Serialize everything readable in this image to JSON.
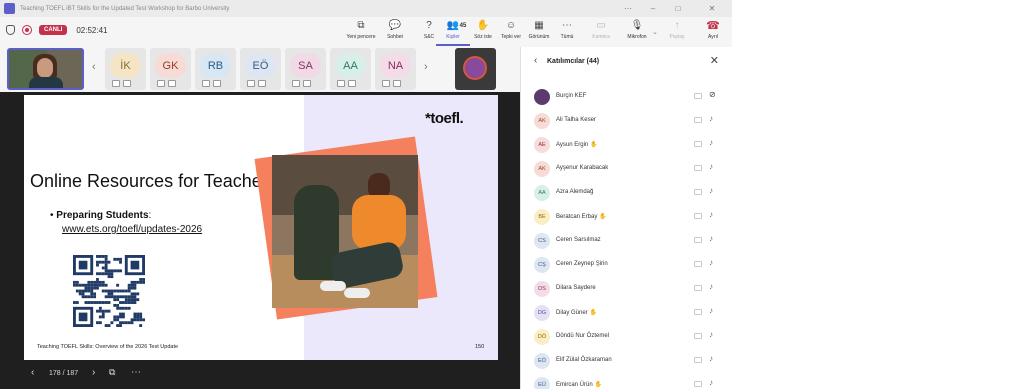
{
  "window": {
    "title": "Teaching TOEFL iBT Skills for the Updated Test Workshop for Barbo University",
    "controls": [
      "–",
      "□",
      "✕"
    ],
    "extra_controls": [
      "⋯",
      "⧉"
    ]
  },
  "meeting": {
    "live_label": "CANLI",
    "timer": "02:52:41"
  },
  "toolbar": [
    {
      "key": "new_window",
      "label": "Yeni pencere",
      "icon": "⧉",
      "state": "normal"
    },
    {
      "key": "chat",
      "label": "Sohbet",
      "icon": "💬",
      "state": "normal"
    },
    {
      "key": "qa",
      "label": "S&C",
      "icon": "?",
      "state": "normal"
    },
    {
      "key": "people",
      "label": "Kişiler",
      "icon": "👥",
      "count": "45",
      "state": "selected"
    },
    {
      "key": "raise",
      "label": "Söz iste",
      "icon": "✋",
      "state": "normal"
    },
    {
      "key": "react",
      "label": "Tepki ver",
      "icon": "☺",
      "state": "normal"
    },
    {
      "key": "view",
      "label": "Görünüm",
      "icon": "▦",
      "state": "normal"
    },
    {
      "key": "more",
      "label": "Tümü",
      "icon": "⋯",
      "state": "normal"
    },
    {
      "key": "camera",
      "label": "Kamera",
      "icon": "▭",
      "state": "disabled"
    },
    {
      "key": "mic",
      "label": "Mikrofon",
      "icon": "🎙",
      "state": "normal"
    },
    {
      "key": "share",
      "label": "Paylaş",
      "icon": "↑",
      "state": "disabled"
    },
    {
      "key": "leave",
      "label": "Ayrıl",
      "icon": "☎",
      "state": "hangup"
    }
  ],
  "gallery": {
    "nav_prev": "‹",
    "nav_next": "›",
    "tiles": [
      {
        "initials": "İK",
        "bg": "#f6e4c6",
        "fg": "#8a6a2a"
      },
      {
        "initials": "GK",
        "bg": "#f7dcd6",
        "fg": "#9a3b2a"
      },
      {
        "initials": "RB",
        "bg": "#d8e7f4",
        "fg": "#2d5a85"
      },
      {
        "initials": "EÖ",
        "bg": "#dde6f2",
        "fg": "#3b5a80"
      },
      {
        "initials": "SA",
        "bg": "#f1d9e5",
        "fg": "#8a3060"
      },
      {
        "initials": "AA",
        "bg": "#d7efe8",
        "fg": "#2c7a66"
      },
      {
        "initials": "NA",
        "bg": "#f3dce7",
        "fg": "#8a2e5c"
      }
    ]
  },
  "slide": {
    "logo": "*toefl.",
    "title": "Online Resources for Teachers",
    "bullet_label": "Preparing Students",
    "bullet_colon": ":",
    "link": "www.ets.org/toefl/updates-2026",
    "footer": "Teaching TOEFL Skills: Overview of the 2026 Test Update",
    "page": "150"
  },
  "nav": {
    "prev": "‹",
    "page_indicator": "178 / 187",
    "next": "›",
    "more": "⋯"
  },
  "panel": {
    "back": "‹",
    "title": "Katılımcılar (44)",
    "close": "✕",
    "participants": [
      {
        "initials": "",
        "name": "Burçin KEF",
        "photo": true,
        "mic": "off",
        "raise": false,
        "bg": "#5b3a6e",
        "fg": "#fff"
      },
      {
        "initials": "AK",
        "name": "Ali Talha Keser",
        "mic": "on",
        "raise": false,
        "bg": "#f7dcd6",
        "fg": "#9a3b2a"
      },
      {
        "initials": "AE",
        "name": "Aysun Ergin",
        "mic": "on",
        "raise": true,
        "bg": "#f6dcdc",
        "fg": "#9a2a2a"
      },
      {
        "initials": "AK",
        "name": "Ayşenur Karabacak",
        "mic": "on",
        "raise": false,
        "bg": "#f7dcd6",
        "fg": "#9a3b2a"
      },
      {
        "initials": "AA",
        "name": "Azra Alemdağ",
        "mic": "on",
        "raise": false,
        "bg": "#d7efe8",
        "fg": "#2c7a66"
      },
      {
        "initials": "BE",
        "name": "Beratcan Erbay",
        "mic": "on",
        "raise": true,
        "bg": "#fbeec5",
        "fg": "#8a6a10"
      },
      {
        "initials": "CS",
        "name": "Ceren Sarsılmaz",
        "mic": "on",
        "raise": false,
        "bg": "#dde6f2",
        "fg": "#3b5a80"
      },
      {
        "initials": "CŞ",
        "name": "Ceren Zeynep Şirin",
        "mic": "on",
        "raise": false,
        "bg": "#dde6f2",
        "fg": "#3b5a80"
      },
      {
        "initials": "DS",
        "name": "Dilara Saydere",
        "mic": "on",
        "raise": false,
        "bg": "#f3dce7",
        "fg": "#8a2e5c"
      },
      {
        "initials": "DG",
        "name": "Dilay Güner",
        "mic": "on",
        "raise": true,
        "bg": "#e6e0f5",
        "fg": "#5a4a9a"
      },
      {
        "initials": "DÖ",
        "name": "Döndü Nur Öztemel",
        "mic": "on",
        "raise": false,
        "bg": "#fbeec5",
        "fg": "#8a6a10"
      },
      {
        "initials": "EÖ",
        "name": "Elif Zülal Özkaraman",
        "mic": "on",
        "raise": false,
        "bg": "#dde6f2",
        "fg": "#3b5a80"
      },
      {
        "initials": "EÜ",
        "name": "Emircan Ürün",
        "mic": "on",
        "raise": true,
        "bg": "#dde6f2",
        "fg": "#3b5a80"
      }
    ]
  },
  "colors": {
    "accent": "#5b5fc7",
    "live": "#c4314b",
    "stage": "#1f1f1f",
    "slide_lavender": "#eae8fa",
    "slide_orange": "#f5805d"
  }
}
